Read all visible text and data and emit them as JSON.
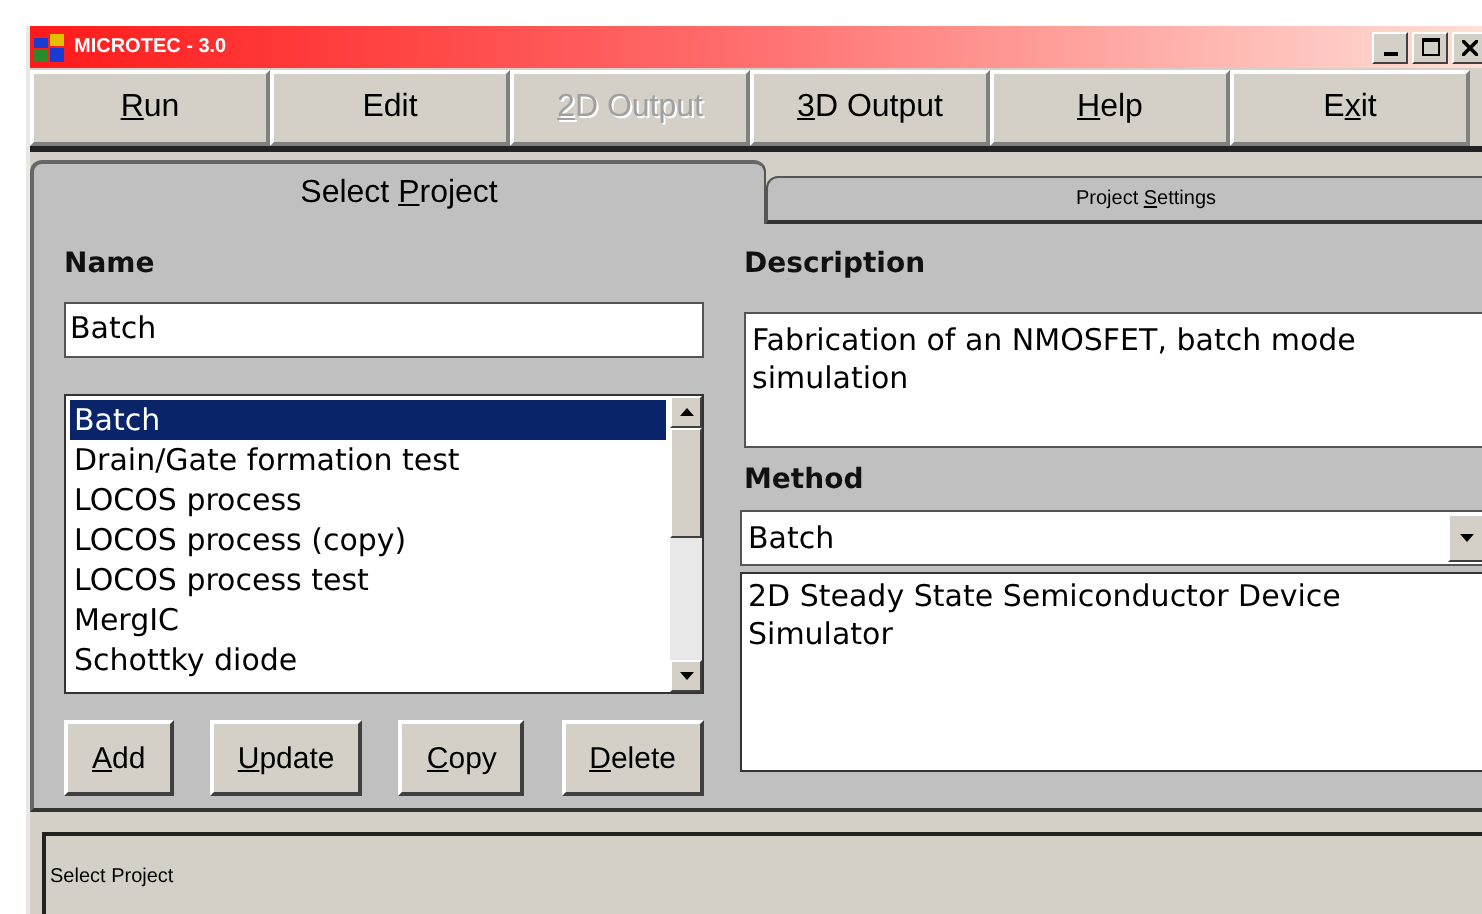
{
  "window": {
    "title": "MICROTEC - 3.0"
  },
  "menu": [
    {
      "parts": {
        "key": "R",
        "after": "un"
      },
      "disabled": false
    },
    {
      "parts": {
        "before": "Edit"
      },
      "disabled": false
    },
    {
      "parts": {
        "key": "2",
        "after": "D Output"
      },
      "disabled": true
    },
    {
      "parts": {
        "key": "3",
        "after": "D Output"
      },
      "disabled": false
    },
    {
      "parts": {
        "key": "H",
        "after": "elp"
      },
      "disabled": false
    },
    {
      "parts": {
        "before": "E",
        "key": "x",
        "after": "it"
      },
      "disabled": false
    }
  ],
  "tabs": [
    {
      "parts": {
        "before": "Select ",
        "key": "P",
        "after": "roject"
      },
      "selected": true
    },
    {
      "parts": {
        "before": "Project ",
        "key": "S",
        "after": "ettings"
      },
      "selected": false
    }
  ],
  "name": {
    "label": "Name",
    "value": "Batch"
  },
  "projects": [
    {
      "label": "Batch",
      "selected": true
    },
    {
      "label": "Drain/Gate formation test",
      "selected": false
    },
    {
      "label": "LOCOS process",
      "selected": false
    },
    {
      "label": "LOCOS process (copy)",
      "selected": false
    },
    {
      "label": "LOCOS process test",
      "selected": false
    },
    {
      "label": "MergIC",
      "selected": false
    },
    {
      "label": "Schottky diode",
      "selected": false
    }
  ],
  "buttons": [
    {
      "parts": {
        "key": "A",
        "after": "dd"
      }
    },
    {
      "parts": {
        "key": "U",
        "after": "pdate"
      }
    },
    {
      "parts": {
        "key": "C",
        "after": "opy"
      }
    },
    {
      "parts": {
        "key": "D",
        "after": "elete"
      }
    }
  ],
  "description": {
    "label": "Description",
    "value": "Fabrication of an NMOSFET, batch mode simulation"
  },
  "method": {
    "label": "Method",
    "value": "Batch",
    "details": "2D Steady State Semiconductor Device Simulator"
  },
  "status_bar": "Select Project"
}
